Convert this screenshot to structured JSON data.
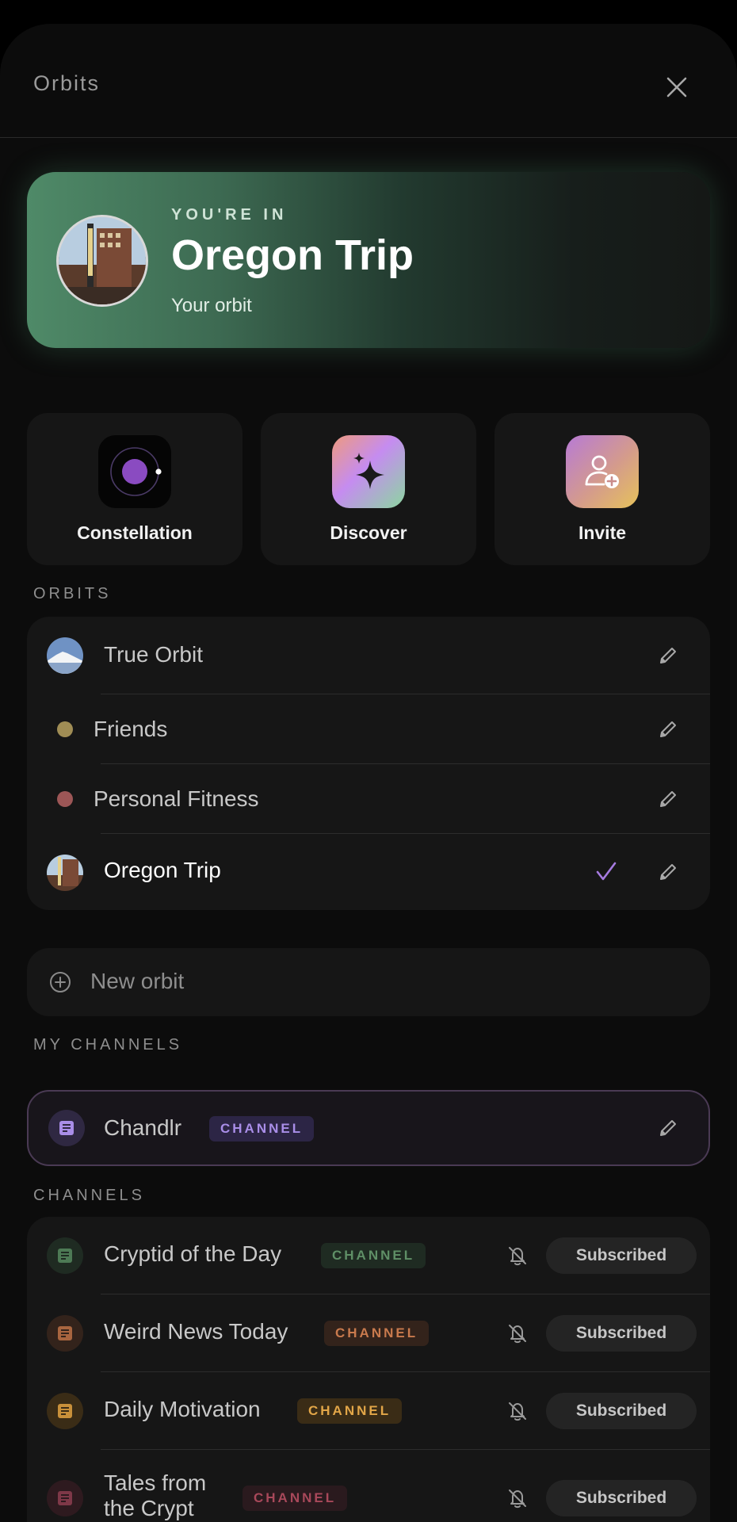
{
  "header": {
    "title": "Orbits"
  },
  "hero": {
    "eyebrow": "YOU'RE IN",
    "title": "Oregon Trip",
    "subtitle": "Your orbit"
  },
  "actions": [
    {
      "label": "Constellation",
      "icon": "constellation-icon"
    },
    {
      "label": "Discover",
      "icon": "sparkle-icon"
    },
    {
      "label": "Invite",
      "icon": "add-user-icon"
    }
  ],
  "orbits_section": {
    "label": "ORBITS"
  },
  "orbits": [
    {
      "label": "True Orbit",
      "marker": "avatar",
      "selected": false
    },
    {
      "label": "Friends",
      "marker": "dot",
      "color": "#a08d55",
      "selected": false
    },
    {
      "label": "Personal Fitness",
      "marker": "dot",
      "color": "#9c5656",
      "selected": false
    },
    {
      "label": "Oregon Trip",
      "marker": "avatar",
      "selected": true
    }
  ],
  "new_orbit": {
    "label": "New orbit"
  },
  "my_channels_section": {
    "label": "MY CHANNELS"
  },
  "my_channel": {
    "name": "Chandlr",
    "badge": "CHANNEL",
    "accent": "#a98ee8"
  },
  "channels_section": {
    "label": "CHANNELS"
  },
  "channels": [
    {
      "name": "Cryptid of the Day",
      "badge": "CHANNEL",
      "accent": "#5f8f66",
      "button": "Subscribed"
    },
    {
      "name": "Weird News Today",
      "badge": "CHANNEL",
      "accent": "#c97a4d",
      "button": "Subscribed"
    },
    {
      "name": "Daily Motivation",
      "badge": "CHANNEL",
      "accent": "#e2a648",
      "button": "Subscribed"
    },
    {
      "name": "Tales from the Crypt",
      "badge": "CHANNEL",
      "accent": "#a8485a",
      "button": "Subscribed"
    }
  ]
}
